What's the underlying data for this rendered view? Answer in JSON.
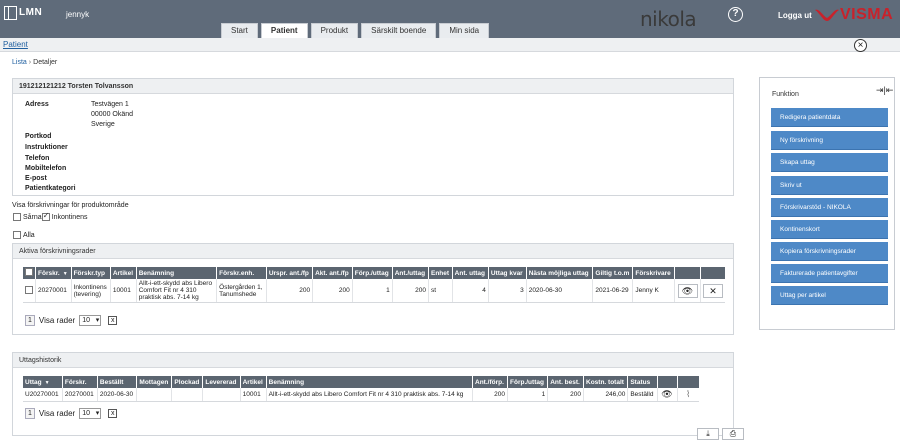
{
  "app": {
    "logo_text": "LMN",
    "user": "jennyk",
    "brand": "nikola",
    "logout": "Logga ut",
    "vendor": "VISMA"
  },
  "tabs": [
    {
      "label": "Start"
    },
    {
      "label": "Patient",
      "active": true
    },
    {
      "label": "Produkt"
    },
    {
      "label": "Särskilt boende"
    },
    {
      "label": "Min sida"
    }
  ],
  "subbar": {
    "link": "Patient"
  },
  "breadcrumb": {
    "list": "Lista",
    "current": "Detaljer"
  },
  "patient": {
    "header": "191212121212   Torsten Tolvansson",
    "fields": [
      {
        "label": "Adress",
        "value": [
          "Testvägen 1",
          "00000 Okänd",
          "Sverige"
        ]
      },
      {
        "label": "Portkod",
        "value": []
      },
      {
        "label": "Instruktioner",
        "value": []
      },
      {
        "label": "Telefon",
        "value": []
      },
      {
        "label": "Mobiltelefon",
        "value": []
      },
      {
        "label": "E-post",
        "value": []
      },
      {
        "label": "Patientkategori",
        "value": []
      }
    ]
  },
  "filters": {
    "title": "Visa förskrivningar för produktområde",
    "sarna": "Sårna",
    "inkontinens": "Inkontinens",
    "alla": "Alla"
  },
  "aktiva": {
    "title": "Aktiva förskrivningsrader",
    "columns": [
      "Förskr.",
      "Förskr.typ",
      "Artikel",
      "Benämning",
      "Förskr.enh.",
      "Urspr. ant./fp",
      "Akt. ant./fp",
      "Förp./uttag",
      "Ant./uttag",
      "Enhet",
      "Ant. uttag",
      "Uttag kvar",
      "Nästa möjliga uttag",
      "Giltig t.o.m",
      "Förskrivare"
    ],
    "row": {
      "forskr": "20270001",
      "typ1": "Inkontinens",
      "typ2": "(tevering)",
      "artikel": "10001",
      "benamning1": "Allt-i-ett-skydd abs Libero",
      "benamning2": "Comfort Fit nr 4 310",
      "benamning3": "praktisk abs. 7-14 kg",
      "enh1": "Östergården 1,",
      "enh2": "Tanumshede",
      "urspr": "200",
      "akt": "200",
      "forp": "1",
      "ant": "200",
      "enhet": "st",
      "antuttag": "4",
      "kvar": "3",
      "nasta": "2020-06-30",
      "giltig": "2021-06-29",
      "forskrivare": "Jenny K"
    },
    "pager": {
      "page": "1",
      "label": "Visa rader",
      "rows": "10"
    }
  },
  "uttag": {
    "title": "Uttagshistorik",
    "columns": [
      "Uttag",
      "Förskr.",
      "Beställt",
      "Mottagen",
      "Plockad",
      "Levererad",
      "Artikel",
      "Benämning",
      "Ant./förp.",
      "Förp./uttag",
      "Ant. best.",
      "Kostn. totalt",
      "Status"
    ],
    "row": {
      "uttag": "U20270001",
      "forskr": "20270001",
      "bestallt": "2020-06-30",
      "mottagen": "",
      "plockad": "",
      "levererad": "",
      "artikel": "10001",
      "benamning": "Allt-i-ett-skydd abs Libero Comfort Fit nr 4 310 praktisk abs. 7-14 kg",
      "antforp": "200",
      "forputtag": "1",
      "antbest": "200",
      "kostn": "246,00",
      "status": "Beställd"
    },
    "pager": {
      "page": "1",
      "label": "Visa rader",
      "rows": "10"
    }
  },
  "funktion": {
    "title": "Funktion",
    "buttons": [
      "Redigera patientdata",
      "Ny förskrivning",
      "Skapa uttag",
      "Skriv ut",
      "Förskrivarstöd - NIKOLA",
      "Kontinenskort",
      "Kopiera förskrivningsrader",
      "Fakturerade patientavgifter",
      "Uttag per artikel"
    ]
  },
  "colors": {
    "topbar": "#5f6b7a",
    "accent": "#4e89c7",
    "visma_red": "#c8222b"
  }
}
